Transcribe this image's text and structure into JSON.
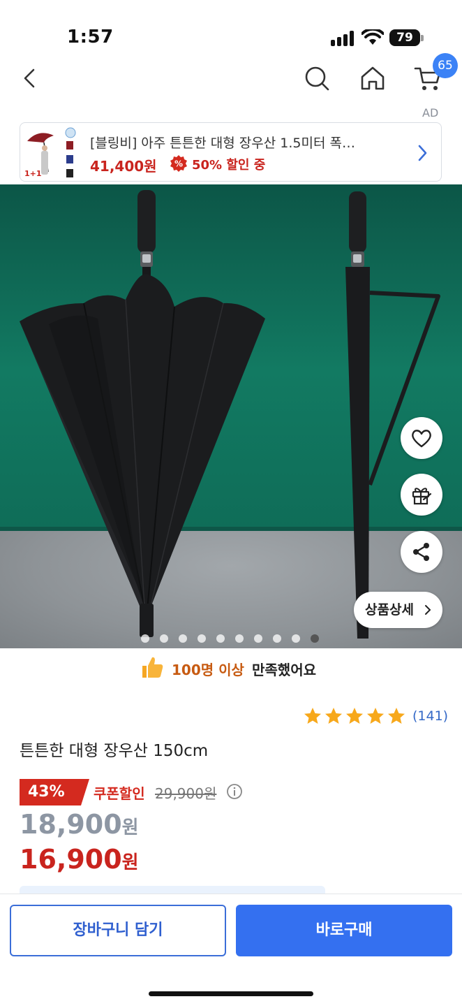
{
  "status_bar": {
    "time": "1:57",
    "battery": "79"
  },
  "nav": {
    "cart_count": "65"
  },
  "ad": {
    "label": "AD",
    "title": "[블링비] 아주 튼튼한 대형 장우산 1.5미터 폭…",
    "price": "41,400원",
    "discount": "50% 할인 중",
    "thumb_badge": "1+1"
  },
  "gallery": {
    "detail_button": "상품상세",
    "dot_count": 10,
    "active_dot": 9
  },
  "satisfaction": {
    "count": "100명 이상",
    "rest": "만족했어요"
  },
  "rating": {
    "stars": 5,
    "review_count": "(141)"
  },
  "product": {
    "title": "튼튼한 대형 장우산 150cm"
  },
  "price": {
    "discount_rate": "43%",
    "coupon_label": "쿠폰할인",
    "original": "29,900원",
    "sale_amount": "18,900",
    "sale_unit": "원",
    "coupon_amount": "16,900",
    "coupon_unit": "원"
  },
  "actions": {
    "cart_button": "장바구니 담기",
    "buy_button": "바로구매"
  },
  "colors": {
    "accent_blue": "#3470f0",
    "sale_red": "#c9241e",
    "badge_blue": "#3b82f6",
    "background_green": "#127a62"
  }
}
